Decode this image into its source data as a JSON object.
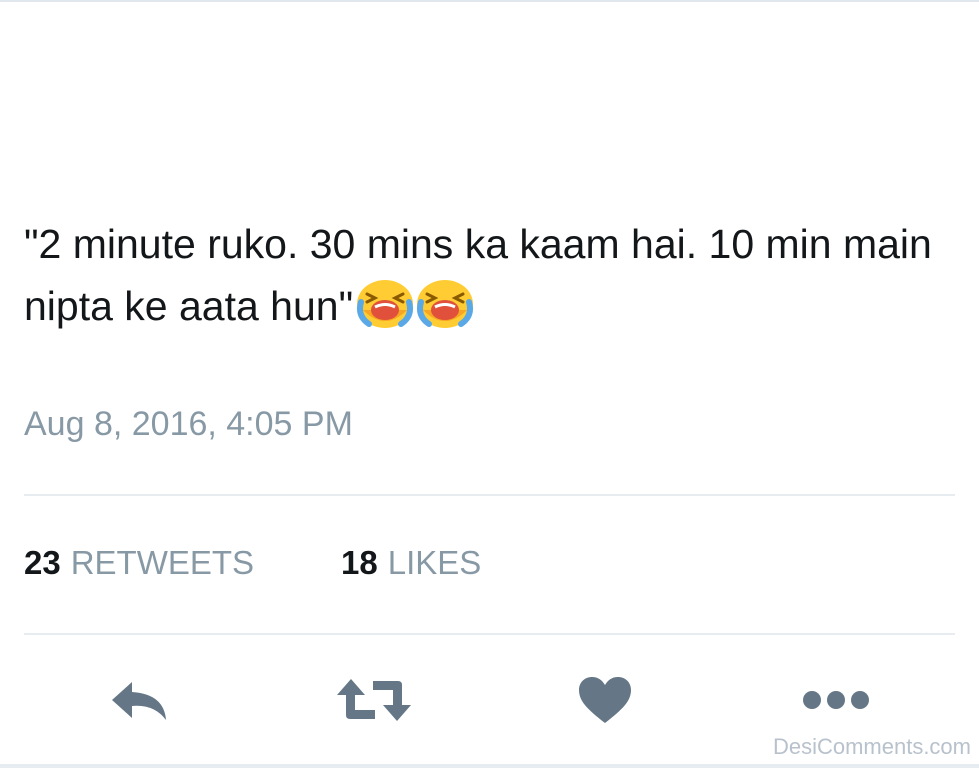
{
  "tweet": {
    "text": "\"2 minute ruko. 30 mins ka kaam hai. 10 min main nipta ke aata hun\"",
    "emojis": [
      "loudly-crying-face-icon",
      "loudly-crying-face-icon"
    ],
    "timestamp": "Aug 8, 2016, 4:05 PM"
  },
  "stats": {
    "retweets_count": "23",
    "retweets_label": "RETWEETS",
    "likes_count": "18",
    "likes_label": "LIKES"
  },
  "actions": [
    {
      "name": "reply",
      "icon": "reply-icon"
    },
    {
      "name": "retweet",
      "icon": "retweet-icon"
    },
    {
      "name": "like",
      "icon": "heart-icon"
    },
    {
      "name": "more",
      "icon": "more-dots-icon"
    }
  ],
  "colors": {
    "text": "#14171a",
    "muted": "#8899a6",
    "icon": "#657786",
    "divider": "#e6ecf0",
    "emoji_face": "#ffcc33"
  },
  "watermark": "DesiComments.com"
}
